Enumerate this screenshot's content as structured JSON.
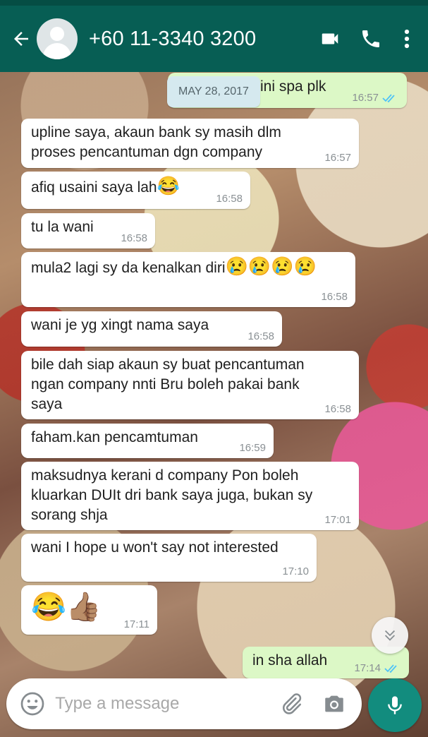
{
  "header": {
    "contact": "+60 11-3340 3200",
    "icons": [
      "back-arrow-icon",
      "avatar",
      "video-call-icon",
      "phone-icon",
      "more-vert-icon"
    ]
  },
  "date_chip": "MAY 28, 2017",
  "messages": [
    {
      "dir": "out",
      "text": "ini spa plk",
      "time": "16:57",
      "ticks": true
    },
    {
      "dir": "in",
      "text": "upline saya, akaun bank sy masih dlm\nproses pencantuman dgn company",
      "time": "16:57"
    },
    {
      "dir": "in",
      "text": "afiq usaini saya lah",
      "emoji": "😂",
      "time": "16:58"
    },
    {
      "dir": "in",
      "text": "tu la wani",
      "time": "16:58"
    },
    {
      "dir": "in",
      "text": "mula2 lagi sy da kenalkan diri",
      "emoji": "😢😢😢😢",
      "time": "16:58"
    },
    {
      "dir": "in",
      "text": "wani je yg xingt nama saya",
      "time": "16:58"
    },
    {
      "dir": "in",
      "text": "bile dah siap akaun sy buat pencantuman\nngan company nnti Bru boleh pakai bank\nsaya",
      "time": "16:58"
    },
    {
      "dir": "in",
      "text": "faham.kan pencamtuman",
      "time": "16:59"
    },
    {
      "dir": "in",
      "text": "maksudnya kerani d company Pon boleh\nkluarkan DUIt dri bank saya juga, bukan sy\nsorang shja",
      "time": "17:01"
    },
    {
      "dir": "in",
      "text": "wani I hope u won't say not interested",
      "time": "17:10"
    },
    {
      "dir": "in",
      "text": "",
      "emoji": "😂👍🏽",
      "time": "17:11"
    },
    {
      "dir": "out",
      "text": "in sha allah",
      "time": "17:14",
      "ticks": true
    }
  ],
  "composer": {
    "placeholder": "Type a message",
    "icons": [
      "emoji-icon",
      "attach-icon",
      "camera-icon",
      "mic-icon"
    ]
  },
  "colors": {
    "header": "#075e54",
    "outgoing_bubble": "#dcf8c6",
    "incoming_bubble": "#ffffff",
    "read_ticks": "#4fc3f7",
    "mic_button": "#128c7e"
  }
}
